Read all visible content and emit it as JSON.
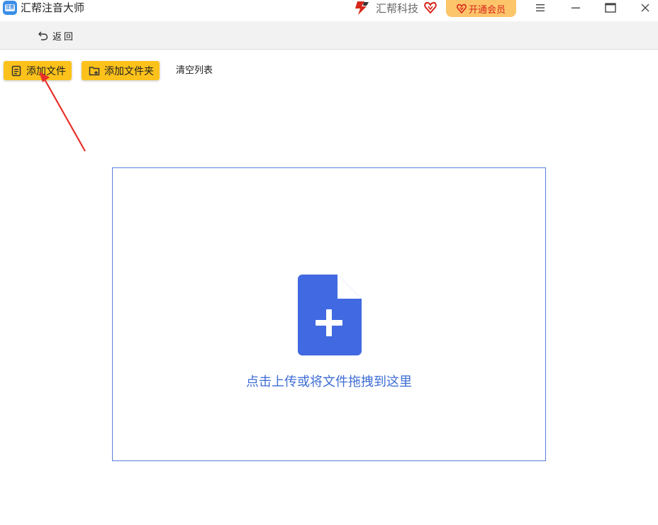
{
  "app": {
    "title": "汇帮注音大师",
    "logo_text": "注音",
    "brand_name": "汇帮科技",
    "vip_label": "开通会员"
  },
  "window_controls": [
    "menu-icon",
    "minimize-icon",
    "maximize-icon",
    "close-icon"
  ],
  "nav": {
    "back_label": "返回"
  },
  "toolbar": {
    "add_file_label": "添加文件",
    "add_folder_label": "添加文件夹",
    "clear_list_label": "清空列表"
  },
  "dropzone": {
    "hint": "点击上传或将文件拖拽到这里",
    "icon": "file-add-icon"
  },
  "colors": {
    "accent_yellow": "#fcc21b",
    "vip_bg": "#fdc56a",
    "vip_text": "#d7261c",
    "primary_blue": "#3e6dd4",
    "annotation_red": "#e8302a"
  }
}
